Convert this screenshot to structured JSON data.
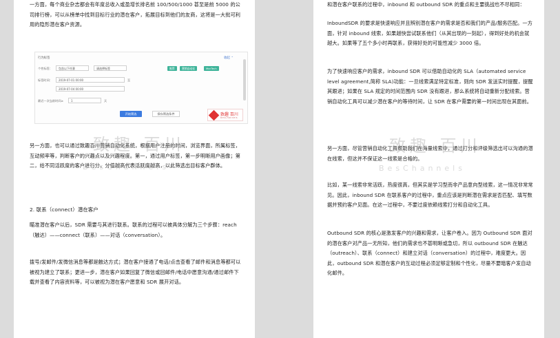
{
  "left_page": {
    "p1": "一方面，每个商业杂志都会有年度总收入或盈增长排名前 100/500/1000 甚至是前 5000 的公司排行榜，可以从榜单中找到目标行业的潜在客户，拓展目标到他们的友商，这将是一大批可利用的隐形潜在客户资源。",
    "screenshot": {
      "title": "行为标签",
      "collapse": "收起 ⌃",
      "row1_label": "个性标签：",
      "row1_select1": "包含以下任意",
      "row1_select2": "请选择标签",
      "tags": [
        "推荐",
        "营销自动化",
        "MarTech"
      ],
      "row2_label": "标签时间：",
      "date1": "2019-07-01 00:00",
      "date2": "2019-07-04 00:00",
      "to_label": "至",
      "row3_label": "最近一次当前时间≥",
      "row3_value": "1",
      "row3_unit": "天",
      "btn_filter": "开始筛选",
      "btn_save": "保存筛选条件",
      "logo_text": "致趣 百川",
      "logo_sub": "BesChannels"
    },
    "p2": "另一方面，也可以通过致趣百川营销自动化系统，根据用户注册的时间，浏览界面，所属标签，互动频率等，判断客户的兴趣点以及兴趣程度。第一，通过用户标签，第一步明晰用户画像；第二，给不同活跃度的客户进行分，分值越高代表活跃度越高，以此筛选出目标客户群体。",
    "h2": "2. 联系（connect）潜在客户",
    "p3": "瞄准潜在客户以后，SDR 需要与其进行联系。联系的过程可以被具体分解为三个步骤：reach（触达）——connect（联系）——对话（conversation）。",
    "p4": "拨号/发邮件/发微信消息等都是触达方式；潜在客户接通了电话/点击查看了邮件和消息等都可以被视为建立了联系；更进一步，潜在客户如果回复了微信或回邮件/电话中愿意沟通/通过邮件下载并查看了内容资料等，可以被视为潜在客户愿意和 SDR 展开对话。"
  },
  "right_page": {
    "p1": "和潜在客户联系的过程中，inbound 和 outbound SDR 的重点和主要挑战也不尽相同：",
    "p2": "InboundSDR 的要求是快速响应并且辨别潜在客户的需求是否和我们的产品/服务匹配。一方面，针对 inbound 线索，如果越快尝试联系他们（从其出现的一刻起），得到好处的机会就越大。如果等了五个多小时再联系，获得好处的可能性减少 3000 倍。",
    "p3": "为了快速响应客户的需求，inbound SDR 可以借助自动化的 SLA（automated service level agreement,简称 SLA)功能：一旦线索满足特定标准，则向 SDR 发送实时提醒，提醒其跟进；如果在 SLA 规定的时间范围内 SDR 没有跟进，那么系统将自动重新分配线索。营销自动化工具可以减少潜在客户的等待时间，让 SDR 在客户需要的第一时间出现在其面前。",
    "p4": "另一方面，尽管营销自动化工具帮助我们在海量线索中，通过打分和评级筛选出可以沟通的潜在线索，但这并不保证这一线索是合格的。",
    "p5": "比如，某一线索非常活跃，热度很高，但其实是学习型而非产品意向型线索，这一情况非常常见。因此，inbound SDR 在联系客户的过程中，重点应该是判断潜在需求是否匹配、填写数据并预约客户见面。在这一过程中，不要过度依赖线索打分和自动化工具。",
    "p6": "Outbound SDR 的核心是激发客户的兴趣和需求，让客户卷入。因为 Outbound SDR 面对的潜在客户对产品一无所知，他们的需求也不甚明晰或急切，所以 outbound SDR 在触达（outreach）、联系（connect）和建立对话（conversation）的过程中，难度更大。因此，outbound SDR 和潜在客户的互动过程必须足够定制和个性化，尽量不要暗客户发自动化邮件。"
  },
  "watermark": {
    "cn": "致趣 百川",
    "en": "BesChannels"
  }
}
